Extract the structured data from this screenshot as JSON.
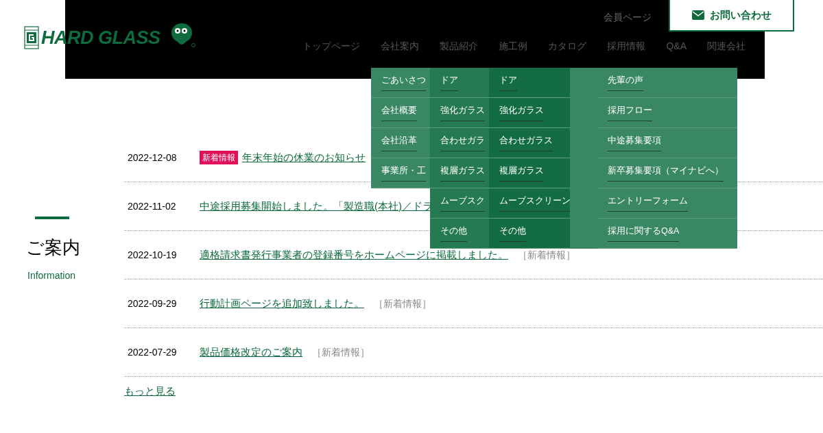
{
  "header": {
    "logo": "HARD GLASS",
    "member_link": "会員ページ",
    "contact_button": "お問い合わせ",
    "nav": [
      {
        "label": "トップページ"
      },
      {
        "label": "会社案内"
      },
      {
        "label": "製品紹介"
      },
      {
        "label": "施工例"
      },
      {
        "label": "カタログ"
      },
      {
        "label": "採用情報"
      },
      {
        "label": "Q&A"
      },
      {
        "label": "関連会社"
      }
    ]
  },
  "dropdowns": [
    {
      "kind": "menu",
      "items": [
        "ごあいさつ",
        "会社概要",
        "会社沿革",
        "事業所・工"
      ]
    },
    {
      "kind": "menu",
      "items": [
        "ドア",
        "強化ガラス",
        "合わせガラ",
        "複層ガラス",
        "ムーブスク",
        "その他"
      ]
    },
    {
      "kind": "menu",
      "items": [
        "ドア",
        "強化ガラス",
        "合わせガラス",
        "複層ガラス",
        "ムーブスクリーン",
        "その他"
      ]
    },
    {
      "kind": "blank"
    },
    {
      "kind": "menu",
      "items": [
        "先輩の声",
        "採用フロー",
        "中途募集要項",
        "新卒募集要項（マイナビへ）",
        "エントリーフォーム",
        "採用に関するQ&A"
      ]
    }
  ],
  "section": {
    "title": "ご案内",
    "subtitle": "Information"
  },
  "news": [
    {
      "date": "2022-12-08",
      "badge": "新着情報",
      "title": "年末年始の休業のお知らせ"
    },
    {
      "date": "2022-11-02",
      "title": "中途採用募集開始しました。「製造職(本社)／ドラ"
    },
    {
      "date": "2022-10-19",
      "title": "適格請求書発行事業者の登録番号をホームページに掲載しました。",
      "category": "［新着情報］"
    },
    {
      "date": "2022-09-29",
      "title": "行動計画ページを追加致しました。",
      "category": "［新着情報］"
    },
    {
      "date": "2022-07-29",
      "title": "製品価格改定のご案内",
      "category": "［新着情報］"
    }
  ],
  "more_link": "もっと見る"
}
